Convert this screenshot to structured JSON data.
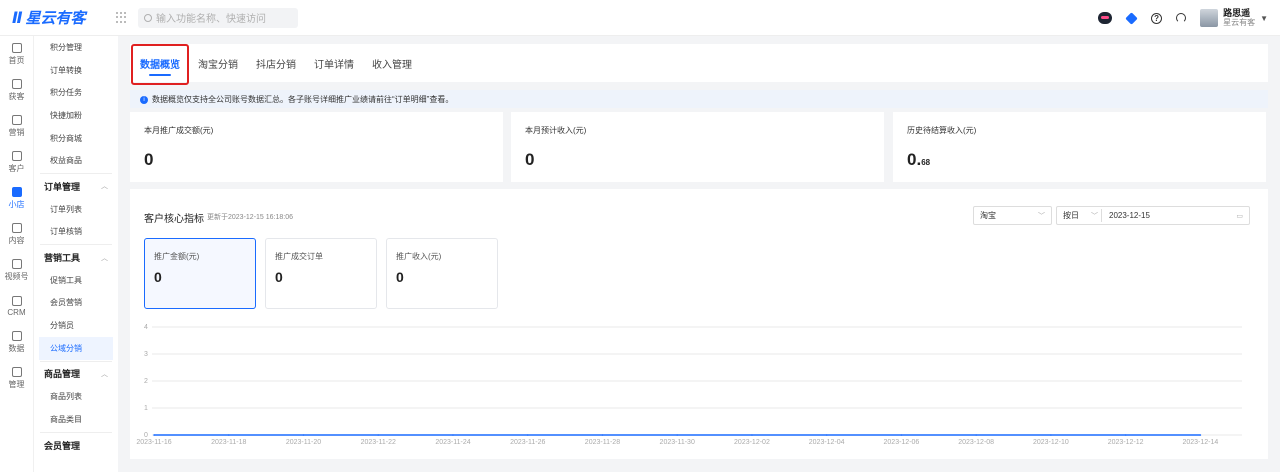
{
  "brand": {
    "name": "星云有客"
  },
  "search": {
    "placeholder": "输入功能名称、快速访问"
  },
  "user": {
    "name": "路思遥",
    "company": "星云有客"
  },
  "rail": [
    {
      "label": "首页",
      "icon": "home-icon"
    },
    {
      "label": "获客",
      "icon": "acquire-icon"
    },
    {
      "label": "营销",
      "icon": "bulb-icon"
    },
    {
      "label": "客户",
      "icon": "customer-icon"
    },
    {
      "label": "小店",
      "icon": "shop-icon",
      "active": true
    },
    {
      "label": "内容",
      "icon": "folder-icon"
    },
    {
      "label": "视频号",
      "icon": "video-icon"
    },
    {
      "label": "CRM",
      "icon": "crm-icon"
    },
    {
      "label": "数据",
      "icon": "pie-icon"
    },
    {
      "label": "管理",
      "icon": "manage-icon"
    }
  ],
  "side_menu": {
    "items_a": [
      "积分管理",
      "订单转换",
      "积分任务",
      "快捷加粉",
      "积分商城",
      "权益商品"
    ],
    "group_order": "订单管理",
    "items_order": [
      "订单列表",
      "订单核销"
    ],
    "group_marketing": "营销工具",
    "items_marketing": [
      "促销工具",
      "会员营销",
      "分销员",
      "公域分销"
    ],
    "group_goods": "商品管理",
    "items_goods": [
      "商品列表",
      "商品类目"
    ],
    "group_member": "会员管理"
  },
  "tabs": [
    "数据概览",
    "淘宝分销",
    "抖店分销",
    "订单详情",
    "收入管理"
  ],
  "notice": "数据概览仅支持全公司账号数据汇总。各子账号详细推广业绩请前往“订单明细”查看。",
  "stats": [
    {
      "label": "本月推广成交额(元)",
      "value": "0"
    },
    {
      "label": "本月预计收入(元)",
      "value": "0"
    },
    {
      "label": "历史待结算收入(元)",
      "value_main": "0.",
      "value_small": "68"
    }
  ],
  "panel": {
    "title": "客户核心指标",
    "updated": "更新于2023-12-15 16:18:06",
    "platform": "淘宝",
    "period": "按日",
    "date": "2023-12-15"
  },
  "kpis": [
    {
      "label": "推广金额(元)",
      "value": "0"
    },
    {
      "label": "推广成交订单",
      "value": "0"
    },
    {
      "label": "推广收入(元)",
      "value": "0"
    }
  ],
  "colors": {
    "accent": "#1a6bff",
    "highlight": "#e02020"
  },
  "chart_data": {
    "type": "line",
    "x": [
      "2023-11-16",
      "2023-11-18",
      "2023-11-20",
      "2023-11-22",
      "2023-11-24",
      "2023-11-26",
      "2023-11-28",
      "2023-11-30",
      "2023-12-02",
      "2023-12-04",
      "2023-12-06",
      "2023-12-08",
      "2023-12-10",
      "2023-12-12",
      "2023-12-14"
    ],
    "series": [
      {
        "values": [
          0,
          0,
          0,
          0,
          0,
          0,
          0,
          0,
          0,
          0,
          0,
          0,
          0,
          0,
          0
        ]
      }
    ],
    "yticks": [
      0,
      1,
      2,
      3,
      4
    ],
    "ylim": [
      0,
      4
    ],
    "grid": true
  }
}
